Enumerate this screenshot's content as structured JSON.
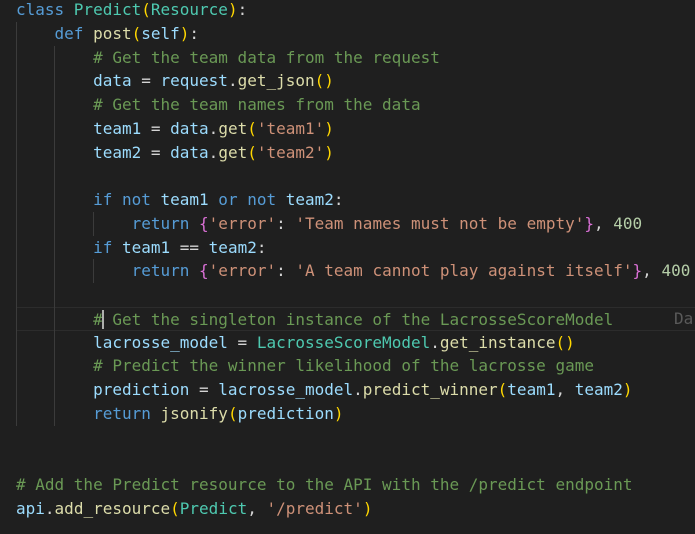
{
  "editor": {
    "colors": {
      "background": "#1f1f1f",
      "keyword": "#569cd6",
      "class": "#4ec9b0",
      "function": "#dcdcaa",
      "variable": "#9cdcfe",
      "string": "#ce9178",
      "number": "#b5cea8",
      "comment": "#6a9955",
      "text": "#cccccc"
    },
    "ghost_text": "Da",
    "lines": [
      {
        "tokens": [
          {
            "t": "class ",
            "c": "kw"
          },
          {
            "t": "Predict",
            "c": "cls"
          },
          {
            "t": "(",
            "c": "b1"
          },
          {
            "t": "Resource",
            "c": "cls"
          },
          {
            "t": ")",
            "c": "b1"
          },
          {
            "t": ":",
            "c": "op"
          }
        ]
      },
      {
        "tokens": [
          {
            "t": "    "
          },
          {
            "t": "def ",
            "c": "kw"
          },
          {
            "t": "post",
            "c": "fn"
          },
          {
            "t": "(",
            "c": "b1"
          },
          {
            "t": "self",
            "c": "var"
          },
          {
            "t": ")",
            "c": "b1"
          },
          {
            "t": ":",
            "c": "op"
          }
        ]
      },
      {
        "tokens": [
          {
            "t": "        "
          },
          {
            "t": "# Get the team data from the request",
            "c": "cm"
          }
        ]
      },
      {
        "tokens": [
          {
            "t": "        "
          },
          {
            "t": "data",
            "c": "var"
          },
          {
            "t": " = ",
            "c": "op"
          },
          {
            "t": "request",
            "c": "var"
          },
          {
            "t": ".",
            "c": "op"
          },
          {
            "t": "get_json",
            "c": "fn"
          },
          {
            "t": "()",
            "c": "b1"
          }
        ]
      },
      {
        "tokens": [
          {
            "t": "        "
          },
          {
            "t": "# Get the team names from the data",
            "c": "cm"
          }
        ]
      },
      {
        "tokens": [
          {
            "t": "        "
          },
          {
            "t": "team1",
            "c": "var"
          },
          {
            "t": " = ",
            "c": "op"
          },
          {
            "t": "data",
            "c": "var"
          },
          {
            "t": ".",
            "c": "op"
          },
          {
            "t": "get",
            "c": "fn"
          },
          {
            "t": "(",
            "c": "b1"
          },
          {
            "t": "'team1'",
            "c": "str"
          },
          {
            "t": ")",
            "c": "b1"
          }
        ]
      },
      {
        "tokens": [
          {
            "t": "        "
          },
          {
            "t": "team2",
            "c": "var"
          },
          {
            "t": " = ",
            "c": "op"
          },
          {
            "t": "data",
            "c": "var"
          },
          {
            "t": ".",
            "c": "op"
          },
          {
            "t": "get",
            "c": "fn"
          },
          {
            "t": "(",
            "c": "b1"
          },
          {
            "t": "'team2'",
            "c": "str"
          },
          {
            "t": ")",
            "c": "b1"
          }
        ]
      },
      {
        "tokens": []
      },
      {
        "tokens": [
          {
            "t": "        "
          },
          {
            "t": "if ",
            "c": "kw"
          },
          {
            "t": "not ",
            "c": "kw"
          },
          {
            "t": "team1",
            "c": "var"
          },
          {
            "t": " or ",
            "c": "kw"
          },
          {
            "t": "not ",
            "c": "kw"
          },
          {
            "t": "team2",
            "c": "var"
          },
          {
            "t": ":",
            "c": "op"
          }
        ]
      },
      {
        "tokens": [
          {
            "t": "            "
          },
          {
            "t": "return ",
            "c": "kw"
          },
          {
            "t": "{",
            "c": "b2"
          },
          {
            "t": "'error'",
            "c": "str"
          },
          {
            "t": ": ",
            "c": "op"
          },
          {
            "t": "'Team names must not be empty'",
            "c": "str"
          },
          {
            "t": "}",
            "c": "b2"
          },
          {
            "t": ", ",
            "c": "op"
          },
          {
            "t": "400",
            "c": "num"
          }
        ]
      },
      {
        "tokens": [
          {
            "t": "        "
          },
          {
            "t": "if ",
            "c": "kw"
          },
          {
            "t": "team1",
            "c": "var"
          },
          {
            "t": " == ",
            "c": "op"
          },
          {
            "t": "team2",
            "c": "var"
          },
          {
            "t": ":",
            "c": "op"
          }
        ]
      },
      {
        "tokens": [
          {
            "t": "            "
          },
          {
            "t": "return ",
            "c": "kw"
          },
          {
            "t": "{",
            "c": "b2"
          },
          {
            "t": "'error'",
            "c": "str"
          },
          {
            "t": ": ",
            "c": "op"
          },
          {
            "t": "'A team cannot play against itself'",
            "c": "str"
          },
          {
            "t": "}",
            "c": "b2"
          },
          {
            "t": ", ",
            "c": "op"
          },
          {
            "t": "400",
            "c": "num"
          }
        ]
      },
      {
        "tokens": []
      },
      {
        "tokens": [
          {
            "t": "        "
          },
          {
            "t": "# Get the singleton instance of the LacrosseScoreModel",
            "c": "cm"
          }
        ]
      },
      {
        "tokens": [
          {
            "t": "        "
          },
          {
            "t": "lacrosse_model",
            "c": "var"
          },
          {
            "t": " = ",
            "c": "op"
          },
          {
            "t": "LacrosseScoreModel",
            "c": "cls"
          },
          {
            "t": ".",
            "c": "op"
          },
          {
            "t": "get_instance",
            "c": "fn"
          },
          {
            "t": "()",
            "c": "b1"
          }
        ]
      },
      {
        "tokens": [
          {
            "t": "        "
          },
          {
            "t": "# Predict the winner likelihood of the lacrosse game",
            "c": "cm"
          }
        ]
      },
      {
        "tokens": [
          {
            "t": "        "
          },
          {
            "t": "prediction",
            "c": "var"
          },
          {
            "t": " = ",
            "c": "op"
          },
          {
            "t": "lacrosse_model",
            "c": "var"
          },
          {
            "t": ".",
            "c": "op"
          },
          {
            "t": "predict_winner",
            "c": "fn"
          },
          {
            "t": "(",
            "c": "b1"
          },
          {
            "t": "team1",
            "c": "var"
          },
          {
            "t": ", ",
            "c": "op"
          },
          {
            "t": "team2",
            "c": "var"
          },
          {
            "t": ")",
            "c": "b1"
          }
        ]
      },
      {
        "tokens": [
          {
            "t": "        "
          },
          {
            "t": "return ",
            "c": "kw"
          },
          {
            "t": "jsonify",
            "c": "fn"
          },
          {
            "t": "(",
            "c": "b1"
          },
          {
            "t": "prediction",
            "c": "var"
          },
          {
            "t": ")",
            "c": "b1"
          }
        ]
      },
      {
        "tokens": []
      },
      {
        "tokens": []
      },
      {
        "tokens": [
          {
            "t": "# Add the Predict resource to the API with the /predict endpoint",
            "c": "cm"
          }
        ]
      },
      {
        "tokens": [
          {
            "t": "api",
            "c": "var"
          },
          {
            "t": ".",
            "c": "op"
          },
          {
            "t": "add_resource",
            "c": "fn"
          },
          {
            "t": "(",
            "c": "b1"
          },
          {
            "t": "Predict",
            "c": "cls"
          },
          {
            "t": ", ",
            "c": "op"
          },
          {
            "t": "'/predict'",
            "c": "str"
          },
          {
            "t": ")",
            "c": "b1"
          }
        ]
      }
    ]
  }
}
